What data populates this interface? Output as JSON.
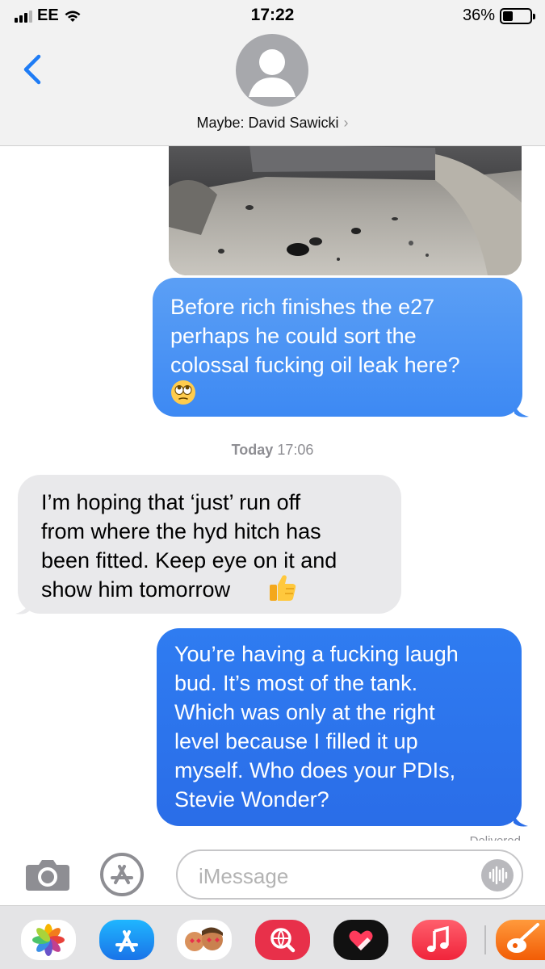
{
  "status_bar": {
    "carrier": "EE",
    "time": "17:22",
    "battery_percent": "36%",
    "battery_level": 0.36
  },
  "header": {
    "contact_name": "Maybe: David Sawicki",
    "chevron": "›"
  },
  "messages": [
    {
      "direction": "outgoing",
      "text": "Before rich finishes the e27\nperhaps he could sort the\ncolossal fucking oil leak here?",
      "emoji": "face-with-rolling-eyes"
    },
    {
      "type": "timestamp",
      "day": "Today",
      "time": "17:06"
    },
    {
      "direction": "incoming",
      "text": "I’m hoping that ‘just’ run off\nfrom where the hyd hitch has\nbeen fitted. Keep eye on it and\nshow him tomorrow",
      "emoji": "thumbs-up"
    },
    {
      "direction": "outgoing",
      "text": "You’re having a fucking laugh\nbud. It’s most of the tank.\nWhich was only at the right\nlevel because I filled it up\nmyself. Who does your PDIs,\nStevie Wonder?"
    }
  ],
  "status": {
    "delivered": "Delivered"
  },
  "input": {
    "placeholder": "iMessage"
  },
  "app_drawer": [
    {
      "name": "photos-app-icon"
    },
    {
      "name": "app-store-icon"
    },
    {
      "name": "memoji-stickers-icon"
    },
    {
      "name": "web-search-icon"
    },
    {
      "name": "digital-touch-icon"
    },
    {
      "name": "music-app-icon"
    },
    {
      "name": "garageband-app-icon"
    }
  ],
  "colors": {
    "outgoing_bubble": "#3d89f3",
    "incoming_bubble": "#e9e9eb",
    "accent": "#2f7cf1"
  }
}
